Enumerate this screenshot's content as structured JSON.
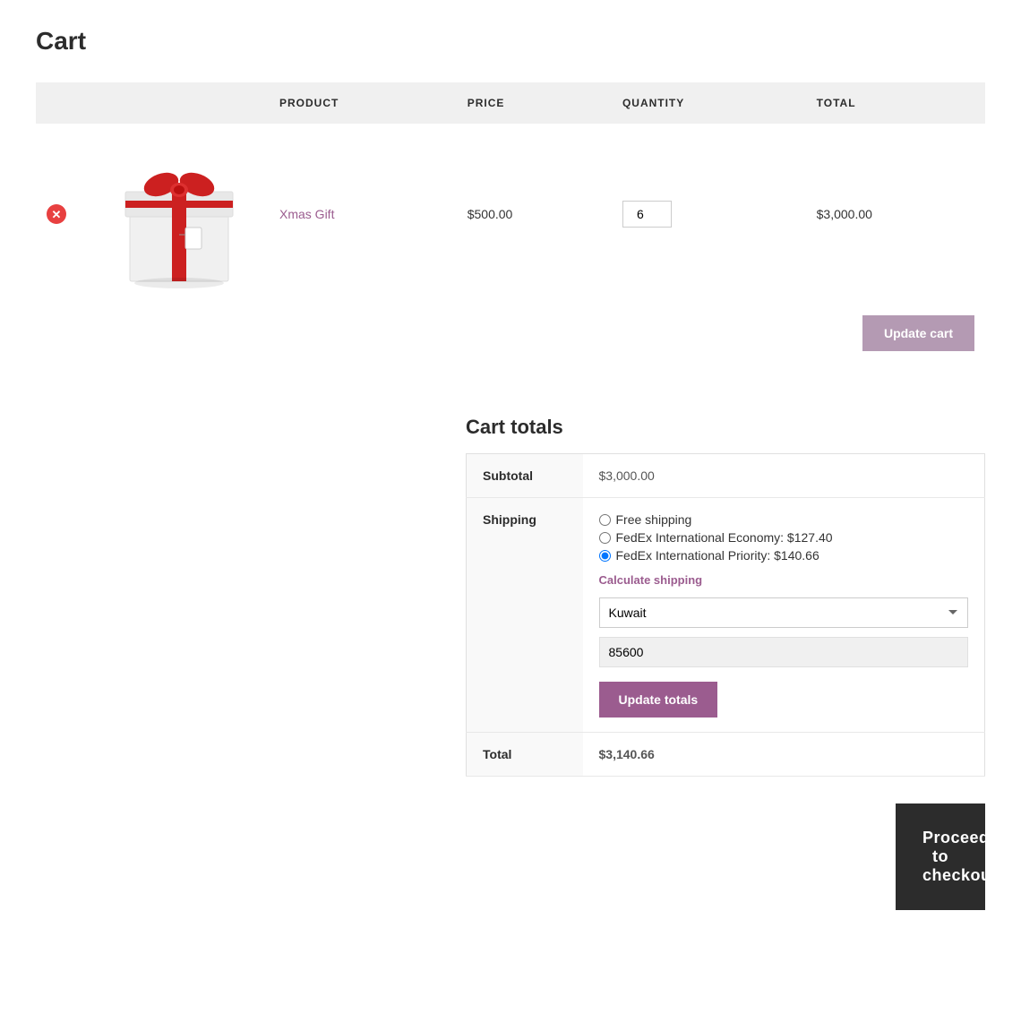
{
  "page": {
    "title": "Cart"
  },
  "table": {
    "headers": {
      "remove": "",
      "image": "",
      "product": "PRODUCT",
      "price": "PRICE",
      "quantity": "QUANTITY",
      "total": "TOTAL"
    },
    "items": [
      {
        "product_name": "Xmas Gift",
        "price": "$500.00",
        "quantity": "6",
        "total": "$3,000.00"
      }
    ],
    "update_cart_label": "Update cart"
  },
  "cart_totals": {
    "title": "Cart totals",
    "subtotal_label": "Subtotal",
    "subtotal_value": "$3,000.00",
    "shipping_label": "Shipping",
    "shipping_options": [
      {
        "label": "Free shipping",
        "value": "free",
        "checked": false
      },
      {
        "label": "FedEx International Economy: $127.40",
        "value": "fedex_economy",
        "checked": false
      },
      {
        "label": "FedEx International Priority: $140.66",
        "value": "fedex_priority",
        "checked": true
      }
    ],
    "calculate_shipping_label": "Calculate shipping",
    "country_value": "Kuwait",
    "postcode_value": "85600",
    "update_totals_label": "Update totals",
    "total_label": "Total",
    "total_value": "$3,140.66"
  },
  "checkout": {
    "proceed_label": "Proceed to checkout",
    "arrow": "→"
  }
}
